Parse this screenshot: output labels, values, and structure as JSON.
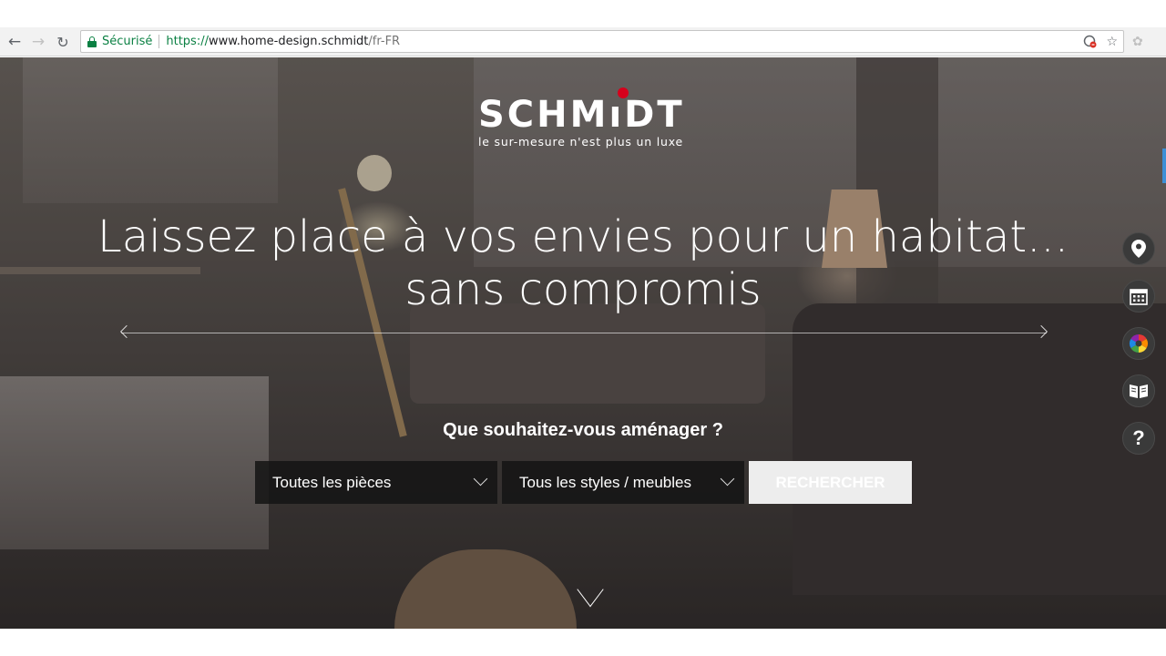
{
  "browser": {
    "secure_label": "Sécurisé",
    "url_scheme": "https://",
    "url_host": "www.home-design.schmidt",
    "url_path": "/fr-FR"
  },
  "brand": {
    "logo_prefix": "SCHM",
    "logo_i": "ı",
    "logo_suffix": "DT",
    "tagline": "le sur-mesure n'est plus un luxe",
    "accent_color": "#d6001c"
  },
  "hero": {
    "headline_line1": "Laissez place à vos envies pour un habitat...",
    "headline_line2": "sans compromis"
  },
  "search": {
    "question": "Que souhaitez-vous aménager ?",
    "rooms_selected": "Toutes les pièces",
    "styles_selected": "Tous les styles / meubles",
    "button_label": "RECHERCHER"
  },
  "side_toolbar": {
    "items": [
      {
        "icon": "map-pin-icon",
        "glyph": ""
      },
      {
        "icon": "calendar-icon",
        "glyph": ""
      },
      {
        "icon": "color-palette-icon",
        "glyph": ""
      },
      {
        "icon": "catalog-book-icon",
        "glyph": ""
      },
      {
        "icon": "help-icon",
        "glyph": "?"
      }
    ]
  }
}
